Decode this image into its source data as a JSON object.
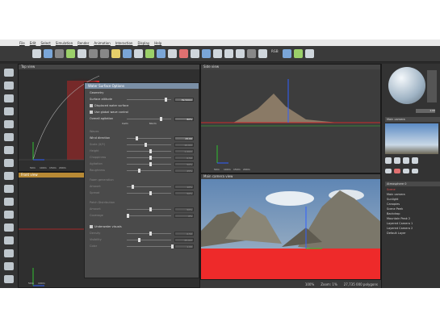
{
  "menu": [
    "File",
    "Edit",
    "Select",
    "Simulation",
    "Render",
    "Animation",
    "Interaction",
    "Display",
    "Help"
  ],
  "toolbar": {
    "button_text": "RGB"
  },
  "viewports": {
    "top": {
      "title": "Top view",
      "scale": [
        "50m",
        "100m",
        "150m",
        "200m"
      ]
    },
    "side": {
      "title": "Side view",
      "scale": [
        "50m",
        "100m",
        "150m",
        "200m"
      ]
    },
    "front": {
      "title": "Front view",
      "scale": [
        "50m",
        "100m"
      ]
    },
    "main_camera": {
      "title": "Main camera view"
    }
  },
  "water_panel": {
    "title": "Water Surface Options",
    "section_geometry": "Geometry",
    "surface_altitude": {
      "label": "Surface altitude",
      "value": "39.500m"
    },
    "option1": "Displaced water surface",
    "option2": "Use global wave control",
    "overall_agitation": {
      "label": "Overall agitation",
      "value": "80%"
    },
    "agitation_ticks": [
      "Calm",
      "Storm"
    ],
    "section_waves": "Waves",
    "rows": [
      {
        "label": "Wind direction",
        "value": "45.00"
      },
      {
        "label": "Scale (X/Y)",
        "value": "10.0m"
      },
      {
        "label": "Height",
        "value": "1.00m"
      },
      {
        "label": "Choppiness",
        "value": "0.50"
      },
      {
        "label": "Agitation",
        "value": "50%"
      },
      {
        "label": "Roughness",
        "value": "25%"
      }
    ],
    "section_foam": "Foam generation",
    "foam_rows": [
      {
        "label": "Amount",
        "value": "10%"
      },
      {
        "label": "Spread",
        "value": "50%"
      }
    ],
    "section_detail": "Patch Distribution",
    "detail_rows": [
      {
        "label": "Amount",
        "value": "50%"
      },
      {
        "label": "Coverage",
        "value": "0%"
      }
    ],
    "underwater": "Underwater visuals",
    "under_rows": [
      {
        "label": "Density",
        "value": "0.50"
      },
      {
        "label": "Visibility",
        "value": "25.0m"
      },
      {
        "label": "Color",
        "value": "1.00"
      }
    ]
  },
  "right_panel": {
    "material_value": "1.00",
    "preview_label": "Main camera",
    "atmosphere_label": "Atmosphere 0",
    "outliner": [
      "Scene",
      "Main camera",
      "Sunlight",
      "Canopies",
      "Scene Peek",
      "Backdrop",
      "Mountain Peak 2",
      "Layered Camera 1",
      "Layered Camera 2",
      "Default Layer"
    ]
  },
  "status": {
    "left": "100%",
    "mid": "Zoom: 1%",
    "right": "27,735 000 polygons"
  },
  "colors": {
    "red_accent": "#e03030",
    "green_axis": "#30c030",
    "blue_axis": "#3060ff"
  }
}
